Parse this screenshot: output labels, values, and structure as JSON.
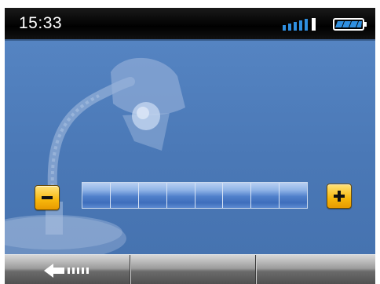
{
  "status_bar": {
    "time": "15:33",
    "signal_icon": "signal-strength-icon",
    "battery_icon": "battery-full-icon"
  },
  "brightness": {
    "illustration": "desk-lamp-icon",
    "minus_icon": "minus-icon",
    "plus_icon": "plus-icon",
    "segments_total": 8,
    "level_fraction": 1.0
  },
  "bottom_bar": {
    "back_icon": "back-arrow-icon"
  },
  "colors": {
    "background": "#4a78b6",
    "button_accent": "#f7b70c",
    "status_bar": "#000000"
  }
}
